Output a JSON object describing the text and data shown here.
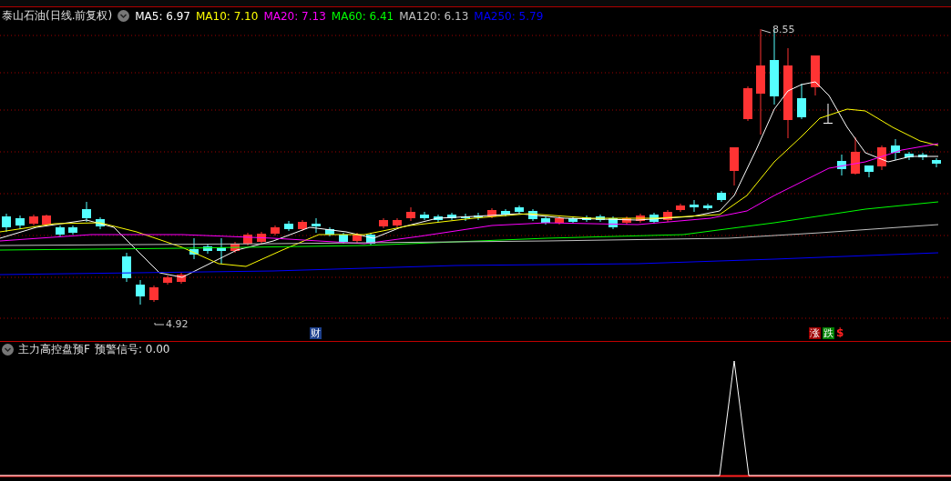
{
  "chart_title": "泰山石油(日线.前复权)",
  "ma_legend": [
    {
      "label": "MA5: 6.97",
      "color": "#ffffff"
    },
    {
      "label": "MA10: 7.10",
      "color": "#ffff00"
    },
    {
      "label": "MA20: 7.13",
      "color": "#ff00ff"
    },
    {
      "label": "MA60: 6.41",
      "color": "#00ff00"
    },
    {
      "label": "MA120: 6.13",
      "color": "#c0c0c0"
    },
    {
      "label": "MA250: 5.79",
      "color": "#0000ff"
    }
  ],
  "price_labels": [
    {
      "kind": "high",
      "text": "8.55"
    },
    {
      "kind": "low",
      "text": "4.92"
    }
  ],
  "event_markers": [
    {
      "kind": "badge",
      "text": "财",
      "color": "#1c3f8c"
    },
    {
      "kind": "badge",
      "text": "涨",
      "color": "#a00000"
    },
    {
      "kind": "badge",
      "text": "跌",
      "color": "#008000"
    },
    {
      "kind": "symbol",
      "text": "$",
      "color": "#ff2020"
    }
  ],
  "indicator": {
    "name": "主力高控盘预F",
    "reading": "预警信号: 0.00"
  }
}
